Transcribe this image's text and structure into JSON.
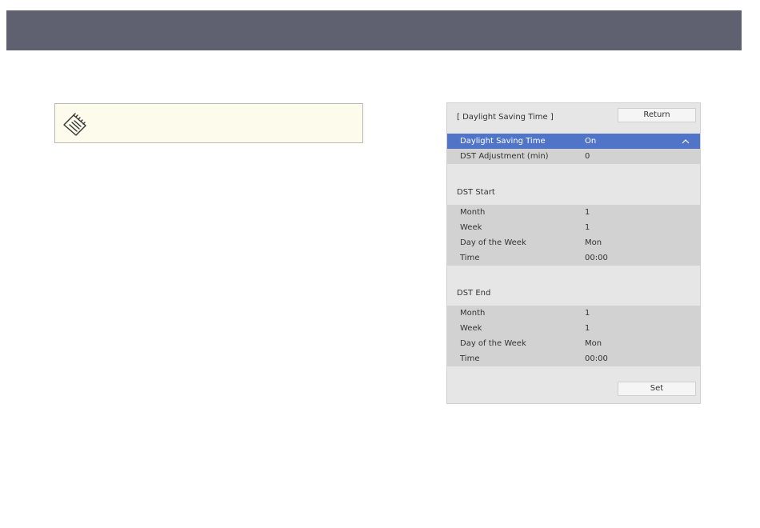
{
  "dialog": {
    "title": "[ Daylight Saving Time ]",
    "return_label": "Return",
    "set_label": "Set",
    "settings": [
      {
        "label": "Daylight Saving Time",
        "value": "On"
      },
      {
        "label": "DST Adjustment (min)",
        "value": "0"
      }
    ],
    "dst_start": {
      "heading": "DST Start",
      "rows": [
        {
          "label": "Month",
          "value": "1"
        },
        {
          "label": "Week",
          "value": "1"
        },
        {
          "label": "Day of the Week",
          "value": "Mon"
        },
        {
          "label": "Time",
          "value": "00:00"
        }
      ]
    },
    "dst_end": {
      "heading": "DST End",
      "rows": [
        {
          "label": "Month",
          "value": "1"
        },
        {
          "label": "Week",
          "value": "1"
        },
        {
          "label": "Day of the Week",
          "value": "Mon"
        },
        {
          "label": "Time",
          "value": "00:00"
        }
      ]
    }
  },
  "colors": {
    "header_bar": "#5f6170",
    "selected_row": "#4f74c8",
    "note_background": "#fdfbec"
  },
  "icons": {
    "note": "memo-pad-icon",
    "selected_row_indicator": "chevron-up-icon"
  }
}
